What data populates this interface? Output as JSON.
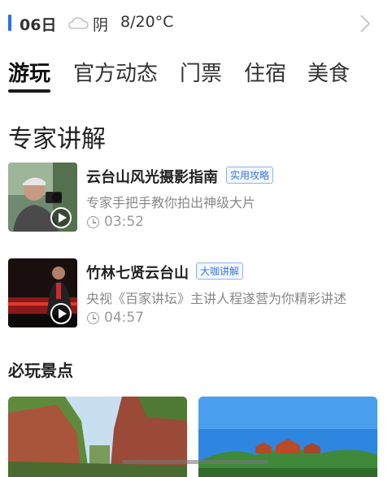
{
  "weather": {
    "date": "06日",
    "condition": "阴",
    "temperature": "8/20°C",
    "icon": "cloud-icon"
  },
  "tabs": [
    {
      "label": "游玩",
      "active": true
    },
    {
      "label": "官方动态",
      "active": false
    },
    {
      "label": "门票",
      "active": false
    },
    {
      "label": "住宿",
      "active": false
    },
    {
      "label": "美食",
      "active": false
    }
  ],
  "expert_section": {
    "title": "专家讲解",
    "items": [
      {
        "title": "云台山风光摄影指南",
        "badge": "实用攻略",
        "description": "专家手把手教你拍出神级大片",
        "duration": "03:52"
      },
      {
        "title": "竹林七贤云台山",
        "badge": "大咖讲解",
        "description": "央视《百家讲坛》主讲人程遂营为你精彩讲述",
        "duration": "04:57"
      }
    ]
  },
  "spots_section": {
    "title": "必玩景点"
  },
  "colors": {
    "accent": "#2f6fe0",
    "badge_text": "#3a78e0"
  }
}
